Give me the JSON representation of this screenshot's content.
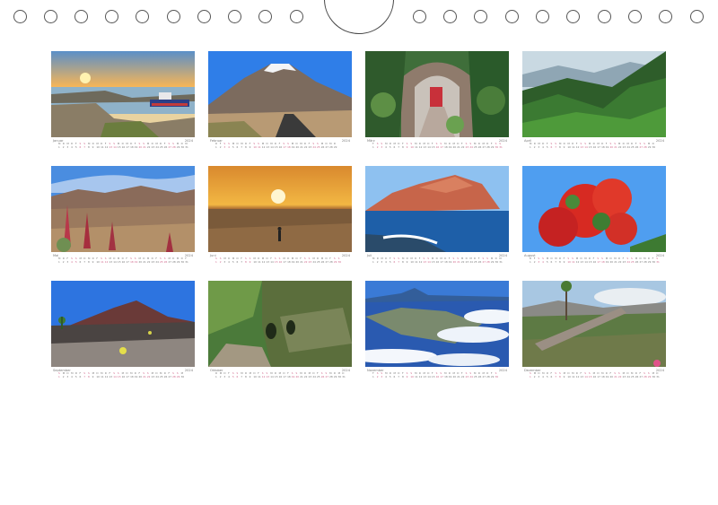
{
  "year": "2024",
  "months": [
    {
      "id": "jan",
      "name": "Januar",
      "days": 31,
      "start": 0
    },
    {
      "id": "feb",
      "name": "Februar",
      "days": 29,
      "start": 3
    },
    {
      "id": "mar",
      "name": "März",
      "days": 31,
      "start": 4
    },
    {
      "id": "apr",
      "name": "April",
      "days": 30,
      "start": 0
    },
    {
      "id": "may",
      "name": "Mai",
      "days": 31,
      "start": 2
    },
    {
      "id": "jun",
      "name": "Juni",
      "days": 30,
      "start": 5
    },
    {
      "id": "jul",
      "name": "Juli",
      "days": 31,
      "start": 0
    },
    {
      "id": "aug",
      "name": "August",
      "days": 31,
      "start": 3
    },
    {
      "id": "sep",
      "name": "September",
      "days": 30,
      "start": 6
    },
    {
      "id": "oct",
      "name": "Oktober",
      "days": 31,
      "start": 1
    },
    {
      "id": "nov",
      "name": "November",
      "days": 30,
      "start": 4
    },
    {
      "id": "dec",
      "name": "Dezember",
      "days": 31,
      "start": 6
    }
  ],
  "weekday_letters": [
    "M",
    "D",
    "M",
    "D",
    "F",
    "S",
    "S"
  ],
  "colors": {
    "weekday": "#777777",
    "weekend": "#d0668a"
  }
}
